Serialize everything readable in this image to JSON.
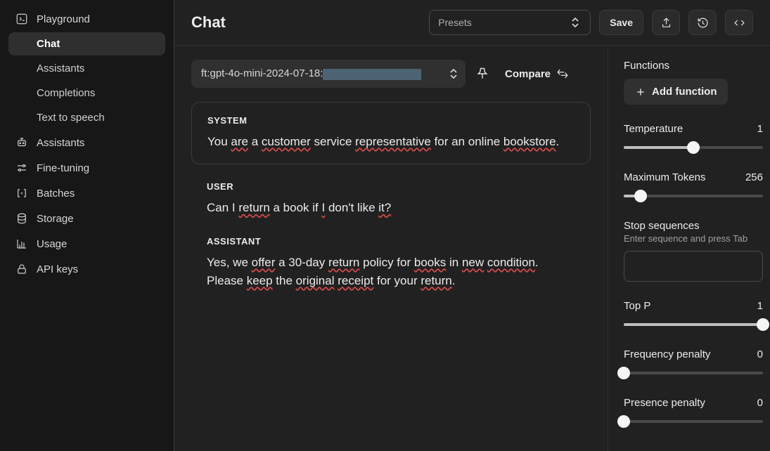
{
  "sidebar": {
    "playground": {
      "label": "Playground"
    },
    "sub": {
      "chat": "Chat",
      "assistants": "Assistants",
      "completions": "Completions",
      "tts": "Text to speech"
    },
    "items": {
      "assistants": "Assistants",
      "finetuning": "Fine-tuning",
      "batches": "Batches",
      "storage": "Storage",
      "usage": "Usage",
      "apikeys": "API keys"
    }
  },
  "header": {
    "title": "Chat",
    "presets_placeholder": "Presets",
    "save": "Save"
  },
  "model": {
    "prefix": "ft:gpt-4o-mini-2024-07-18:",
    "compare": "Compare"
  },
  "messages": {
    "system_label": "SYSTEM",
    "system_text_pre": "You ",
    "system_w1": "are",
    "system_text_mid1": " a ",
    "system_w2": "customer",
    "system_text_mid2": " service ",
    "system_w3": "representative",
    "system_text_mid3": " for an online ",
    "system_w4": "bookstore",
    "system_text_end": ".",
    "user_label": "USER",
    "user_pre": "Can I ",
    "user_w1": "return",
    "user_mid1": " a book if ",
    "user_w2": "I",
    "user_mid2": " don't like ",
    "user_w3": "it?",
    "assistant_label": "ASSISTANT",
    "asst_pre": "Yes, we ",
    "asst_w1": "offer",
    "asst_mid1": " a 30-day ",
    "asst_w2": "return",
    "asst_mid2": " policy for ",
    "asst_w3": "books",
    "asst_mid3": " in ",
    "asst_w4": "new",
    "asst_mid4": " ",
    "asst_w5": "condition",
    "asst_mid5": ". Please ",
    "asst_w6": "keep",
    "asst_mid6": " the ",
    "asst_w7": "original",
    "asst_mid7": " ",
    "asst_w8": "receipt",
    "asst_mid8": " for your ",
    "asst_w9": "return",
    "asst_end": "."
  },
  "rpanel": {
    "functions_label": "Functions",
    "add_function": "Add function",
    "temperature_label": "Temperature",
    "temperature_value": "1",
    "max_tokens_label": "Maximum Tokens",
    "max_tokens_value": "256",
    "stop_label": "Stop sequences",
    "stop_hint": "Enter sequence and press Tab",
    "top_p_label": "Top P",
    "top_p_value": "1",
    "freq_label": "Frequency penalty",
    "freq_value": "0",
    "pres_label": "Presence penalty",
    "pres_value": "0"
  }
}
